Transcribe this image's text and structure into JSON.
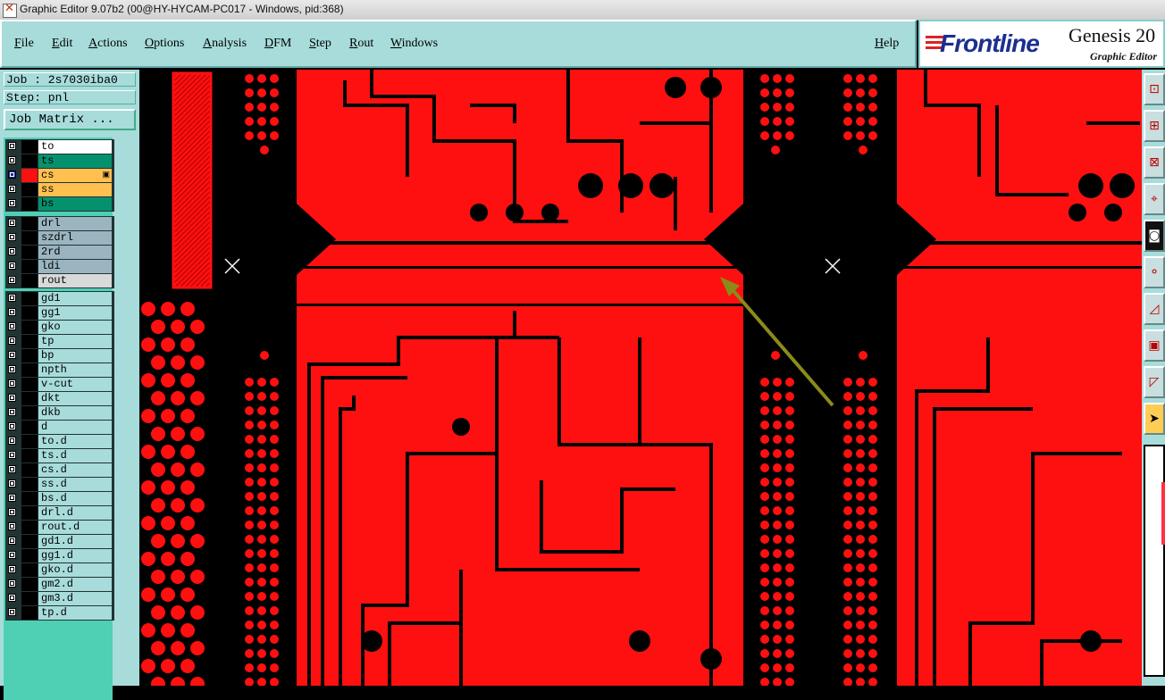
{
  "window": {
    "title": "Graphic Editor 9.07b2 (00@HY-HYCAM-PC017 - Windows, pid:368)"
  },
  "menu": {
    "items": [
      "File",
      "Edit",
      "Actions",
      "Options",
      "Analysis",
      "DFM",
      "Step",
      "Rout",
      "Windows"
    ],
    "help": "Help"
  },
  "brand": {
    "logo": "Frontline",
    "product": "Genesis 20",
    "subtitle": "Graphic Editor"
  },
  "job": {
    "job_label": "Job : 2s7030iba0",
    "step_label": "Step: pnl",
    "matrix_button": "Job Matrix ..."
  },
  "layers": {
    "board": [
      {
        "name": "to",
        "color": "white"
      },
      {
        "name": "ts",
        "color": "green"
      },
      {
        "name": "cs",
        "color": "orange",
        "active": true
      },
      {
        "name": "ss",
        "color": "orange"
      },
      {
        "name": "bs",
        "color": "green"
      }
    ],
    "drill": [
      {
        "name": "drl",
        "color": "grey"
      },
      {
        "name": "szdrl",
        "color": "grey"
      },
      {
        "name": "2rd",
        "color": "grey"
      },
      {
        "name": "ldi",
        "color": "grey"
      },
      {
        "name": "rout",
        "color": "lightgrey"
      }
    ],
    "misc": [
      {
        "name": "gd1"
      },
      {
        "name": "gg1"
      },
      {
        "name": "gko"
      },
      {
        "name": "tp"
      },
      {
        "name": "bp"
      },
      {
        "name": "npth"
      },
      {
        "name": "v-cut"
      },
      {
        "name": "dkt"
      },
      {
        "name": "dkb"
      },
      {
        "name": "d"
      },
      {
        "name": "to.d"
      },
      {
        "name": "ts.d"
      },
      {
        "name": "cs.d"
      },
      {
        "name": "ss.d"
      },
      {
        "name": "bs.d"
      },
      {
        "name": "drl.d"
      },
      {
        "name": "rout.d"
      },
      {
        "name": "gd1.d"
      },
      {
        "name": "gg1.d"
      },
      {
        "name": "gko.d"
      },
      {
        "name": "gm2.d"
      },
      {
        "name": "gm3.d"
      },
      {
        "name": "tp.d"
      }
    ]
  },
  "colors": {
    "copper": "#ff1010",
    "panel": "#a7dcdb",
    "arrow": "#8b8b1a"
  },
  "toolbar": {
    "tools": [
      {
        "icon": "snap-icon"
      },
      {
        "icon": "zoom-icon"
      },
      {
        "icon": "pan-icon"
      },
      {
        "icon": "measure-icon"
      },
      {
        "icon": "feature-icon"
      },
      {
        "icon": "net-icon"
      },
      {
        "icon": "line-icon"
      },
      {
        "icon": "select-area-icon"
      },
      {
        "icon": "arc-icon"
      },
      {
        "icon": "pointer-icon"
      }
    ]
  }
}
